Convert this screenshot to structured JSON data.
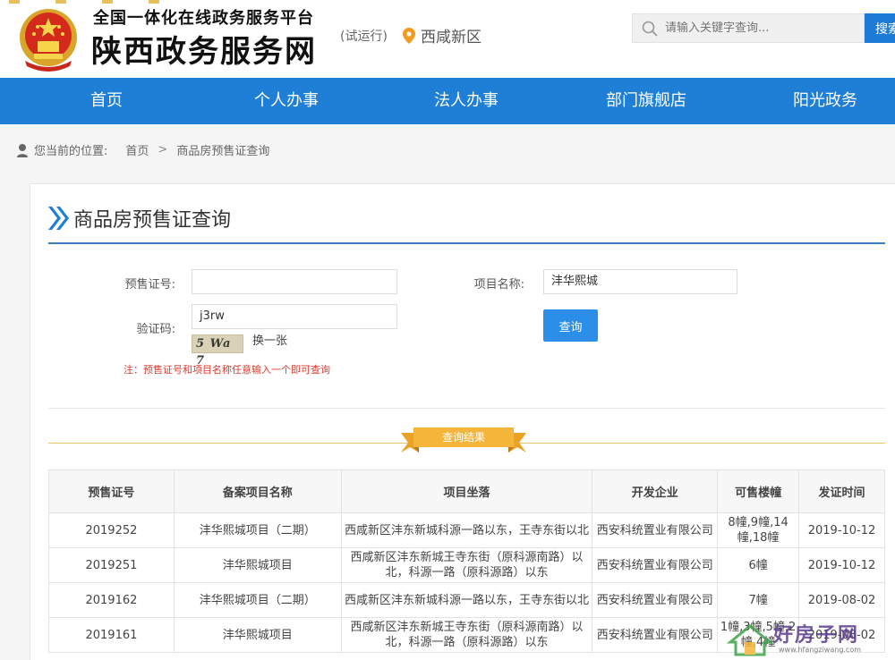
{
  "header": {
    "subtitle": "全国一体化在线政务服务平台",
    "title": "陕西政务服务网",
    "trial": "(试运行)",
    "location": "西咸新区",
    "search_placeholder": "请输入关键字查询...",
    "search_button": "搜索"
  },
  "nav": [
    "首页",
    "个人办事",
    "法人办事",
    "部门旗舰店",
    "阳光政务"
  ],
  "breadcrumb": {
    "prefix": "您当前的位置:",
    "home": "首页",
    "sep": ">",
    "current": "商品房预售证查询"
  },
  "panel": {
    "title": "商品房预售证查询",
    "form": {
      "presale_label": "预售证号:",
      "presale_value": "",
      "project_label": "项目名称:",
      "project_value": "沣华熙城",
      "captcha_label": "验证码:",
      "captcha_value": "j3rw",
      "captcha_image_text": "5 Wa 7",
      "refresh": "换一张",
      "query_button": "查询",
      "note": "注：预售证号和项目名称任意输入一个即可查询"
    },
    "results_label": "查询结果"
  },
  "table": {
    "headers": [
      "预售证号",
      "备案项目名称",
      "项目坐落",
      "开发企业",
      "可售楼幢",
      "发证时间"
    ],
    "rows": [
      [
        "2019252",
        "沣华熙城项目（二期）",
        "西咸新区沣东新城科源一路以东，王寺东街以北",
        "西安科统置业有限公司",
        "8幢,9幢,14幢,18幢",
        "2019-10-12"
      ],
      [
        "2019251",
        "沣华熙城项目",
        "西咸新区沣东新城王寺东街（原科源南路）以北，科源一路（原科源路）以东",
        "西安科统置业有限公司",
        "6幢",
        "2019-10-12"
      ],
      [
        "2019162",
        "沣华熙城项目（二期）",
        "西咸新区沣东新城科源一路以东，王寺东街以北",
        "西安科统置业有限公司",
        "7幢",
        "2019-08-02"
      ],
      [
        "2019161",
        "沣华熙城项目",
        "西咸新区沣东新城王寺东街（原科源南路）以北，科源一路（原科源路）以东",
        "西安科统置业有限公司",
        "1幢,3幢,5幢,2幢,4幢",
        "2019-08-02"
      ]
    ]
  },
  "watermark": {
    "text": "好房子网",
    "url": "www.hfangziwang.com"
  },
  "colors": {
    "nav_blue": "#1f7fd7",
    "button_blue": "#2b8ee8",
    "note_red": "#e03a2e",
    "ribbon_gold": "#f5b53a"
  }
}
